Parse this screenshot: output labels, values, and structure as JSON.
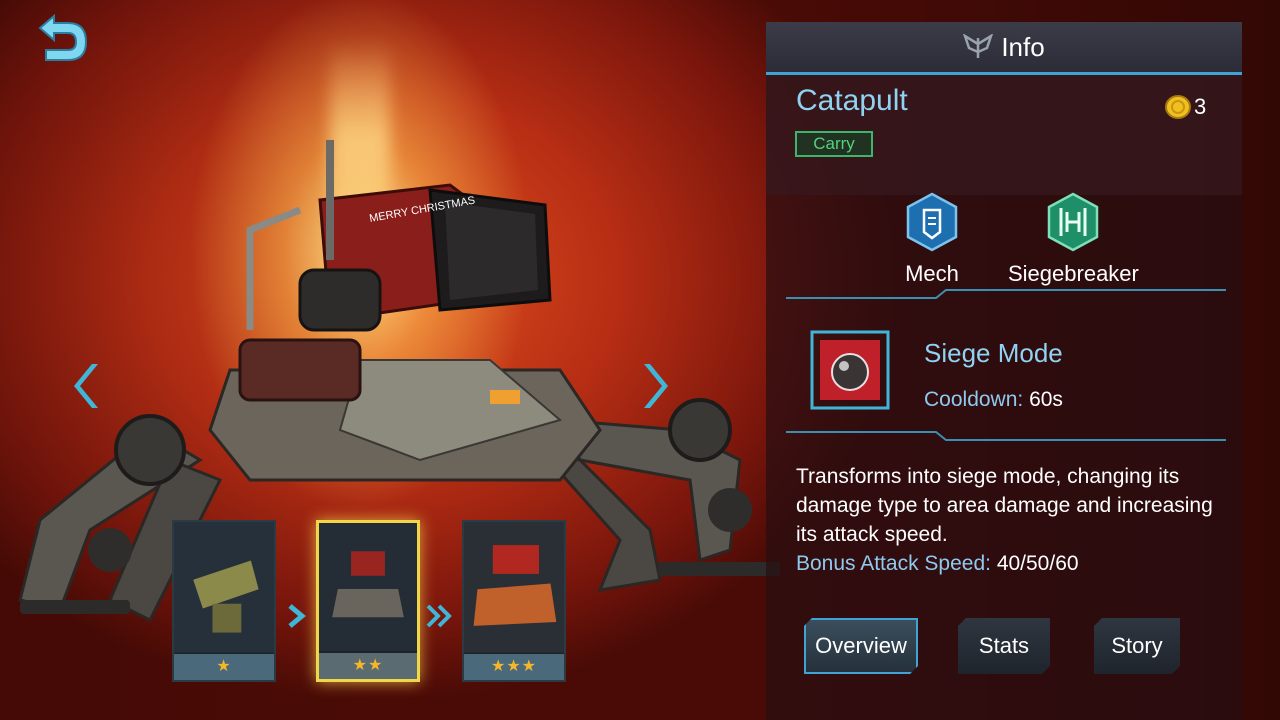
{
  "header": {
    "title": "Info",
    "icon": "wings-emblem-icon"
  },
  "hero": {
    "name": "Catapult",
    "role": "Carry",
    "cost": "3",
    "cost_icon": "gold-coin-icon",
    "traits": [
      {
        "label": "Mech",
        "icon": "mech-shield-icon",
        "color": "#1e6fb0"
      },
      {
        "label": "Siegebreaker",
        "icon": "siegebreaker-gate-icon",
        "color": "#1f8f6a"
      }
    ]
  },
  "skill": {
    "name": "Siege Mode",
    "cooldown_label": "Cooldown:",
    "cooldown_value": "60s",
    "description": "Transforms into siege mode, changing its damage type to area damage and increasing its attack speed.",
    "bonus_label": "Bonus Attack Speed:",
    "bonus_value": "40/50/60"
  },
  "evolutions": [
    {
      "stars": "★",
      "selected": false
    },
    {
      "stars": "★★",
      "selected": true
    },
    {
      "stars": "★★★",
      "selected": false
    }
  ],
  "tabs": [
    {
      "label": "Overview",
      "active": true
    },
    {
      "label": "Stats",
      "active": false
    },
    {
      "label": "Story",
      "active": false
    }
  ],
  "model_decal": "MERRY CHRISTMAS",
  "colors": {
    "accent_blue": "#3fa3d4",
    "hero_name": "#8fd2f2",
    "role_green": "#53d07e",
    "star_gold": "#f5b62a",
    "selected_gold": "#f2d64a"
  }
}
